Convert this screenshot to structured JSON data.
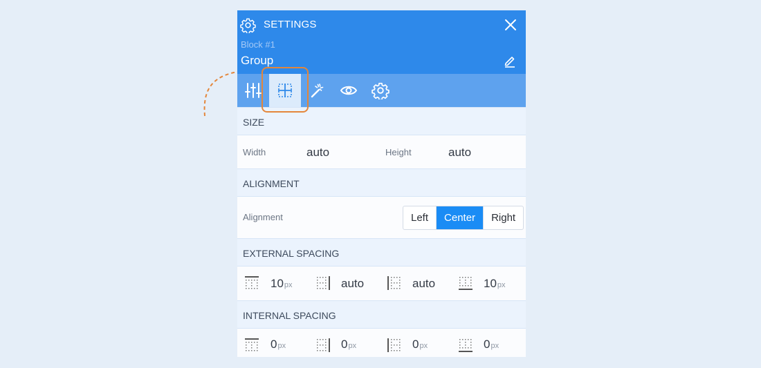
{
  "header": {
    "title": "SETTINGS",
    "block_label": "Block #1",
    "name": "Group"
  },
  "tabs": [
    {
      "name": "adjustments",
      "active": false
    },
    {
      "name": "layout",
      "active": true
    },
    {
      "name": "effects",
      "active": false
    },
    {
      "name": "visibility",
      "active": false
    },
    {
      "name": "advanced",
      "active": false
    }
  ],
  "size": {
    "heading": "SIZE",
    "width_label": "Width",
    "width_value": "auto",
    "height_label": "Height",
    "height_value": "auto"
  },
  "alignment": {
    "heading": "ALIGNMENT",
    "label": "Alignment",
    "options": [
      "Left",
      "Center",
      "Right"
    ],
    "selected": "Center"
  },
  "external_spacing": {
    "heading": "EXTERNAL SPACING",
    "top": "10",
    "top_unit": "px",
    "right": "auto",
    "left": "auto",
    "bottom": "10",
    "bottom_unit": "px"
  },
  "internal_spacing": {
    "heading": "INTERNAL SPACING",
    "top": "0",
    "top_unit": "px",
    "right": "0",
    "right_unit": "px",
    "left": "0",
    "left_unit": "px",
    "bottom": "0",
    "bottom_unit": "px"
  },
  "colors": {
    "header_bg": "#2e89ea",
    "tabs_bg": "#5ea2ee",
    "active_tab_bg": "#dcebfb",
    "accent": "#1a8cf5",
    "highlight": "#e4863a",
    "page_bg": "#e5eef8"
  }
}
